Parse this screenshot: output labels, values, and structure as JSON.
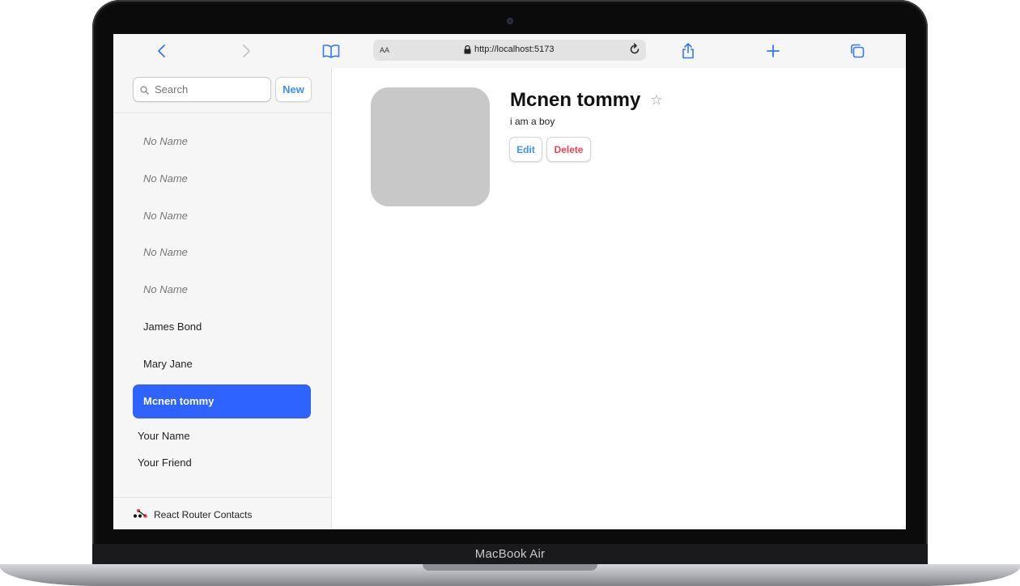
{
  "device": {
    "brand": "MacBook Air"
  },
  "browser": {
    "text_size_label": "AA",
    "url": "http://localhost:5173"
  },
  "sidebar": {
    "search_placeholder": "Search",
    "new_label": "New",
    "contacts": [
      {
        "label": "No Name",
        "style": "noname"
      },
      {
        "label": "No Name",
        "style": "noname"
      },
      {
        "label": "No Name",
        "style": "noname"
      },
      {
        "label": "No Name",
        "style": "noname"
      },
      {
        "label": "No Name",
        "style": "noname"
      },
      {
        "label": "James Bond",
        "style": "normal"
      },
      {
        "label": "Mary Jane",
        "style": "normal"
      },
      {
        "label": "Mcnen tommy",
        "style": "active"
      }
    ],
    "extra_links": [
      "Your Name",
      "Your Friend"
    ],
    "footer_label": "React Router Contacts"
  },
  "detail": {
    "name": "Mcnen tommy",
    "favorite_icon": "☆",
    "notes": "i am a boy",
    "edit_label": "Edit",
    "delete_label": "Delete"
  },
  "colors": {
    "accent": "#2f63ff",
    "link": "#3992ff",
    "danger": "#f44250"
  }
}
